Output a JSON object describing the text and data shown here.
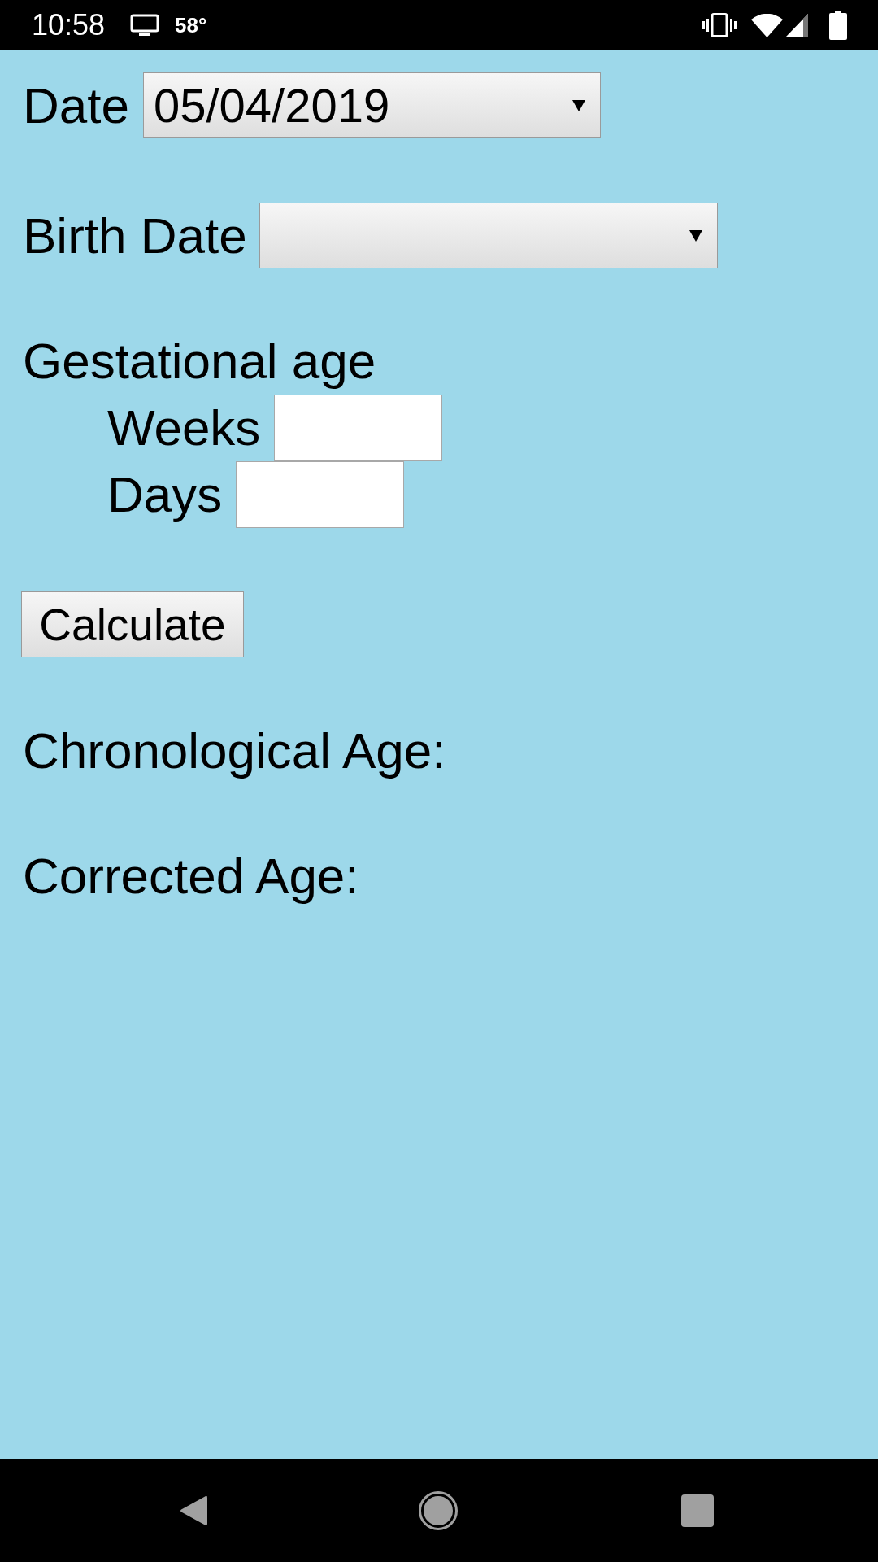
{
  "status_bar": {
    "time": "10:58",
    "temperature": "58°"
  },
  "form": {
    "date": {
      "label": "Date",
      "value": "05/04/2019"
    },
    "birth_date": {
      "label": "Birth Date"
    },
    "gestational_age": {
      "heading": "Gestational age",
      "fields": [
        {
          "label": "Weeks"
        },
        {
          "label": "Days"
        }
      ]
    },
    "button": "Calculate",
    "results": [
      {
        "label": "Chronological Age:"
      },
      {
        "label": "Corrected Age:"
      }
    ]
  }
}
